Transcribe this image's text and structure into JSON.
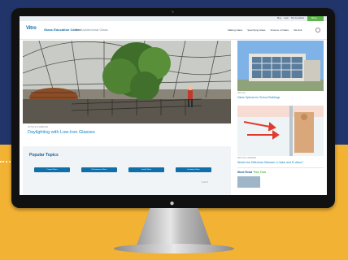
{
  "colors": {
    "brand_blue": "#0f6fa8",
    "link_blue": "#1484c4",
    "accent_green": "#5bb548",
    "background_navy": "#22356b",
    "background_gold": "#f2b233"
  },
  "topbar": {
    "links": [
      "Blog",
      "Login",
      "Site Feedback",
      "Share"
    ]
  },
  "header": {
    "logo": "Vitro",
    "title": "Glass Education Center",
    "subtitle": "Vitro Architectural Glass",
    "nav": [
      "Making Glass",
      "Specifying Glass",
      "Science of Glass",
      "CE Hub"
    ]
  },
  "hero": {
    "kicker": "ARTICLE & WEBINAR",
    "title": "Daylighting with Low-Iron Glasses"
  },
  "popular": {
    "title": "Popular Topics",
    "pills": [
      "Coated Glass",
      "Performance Glass",
      "Low-E Glass",
      "Insulating Glass"
    ],
    "page": "1 of 3"
  },
  "sidebar": {
    "card1": {
      "kicker": "ARTICLE",
      "title": "Glass Options for School Buildings"
    },
    "card2": {
      "kicker": "ARTICLE & WEBINAR",
      "title": "What's the Difference Between U-Value and R-Value?"
    },
    "most_read": {
      "label_main": "Most Read",
      "label_accent": "This Year"
    }
  }
}
